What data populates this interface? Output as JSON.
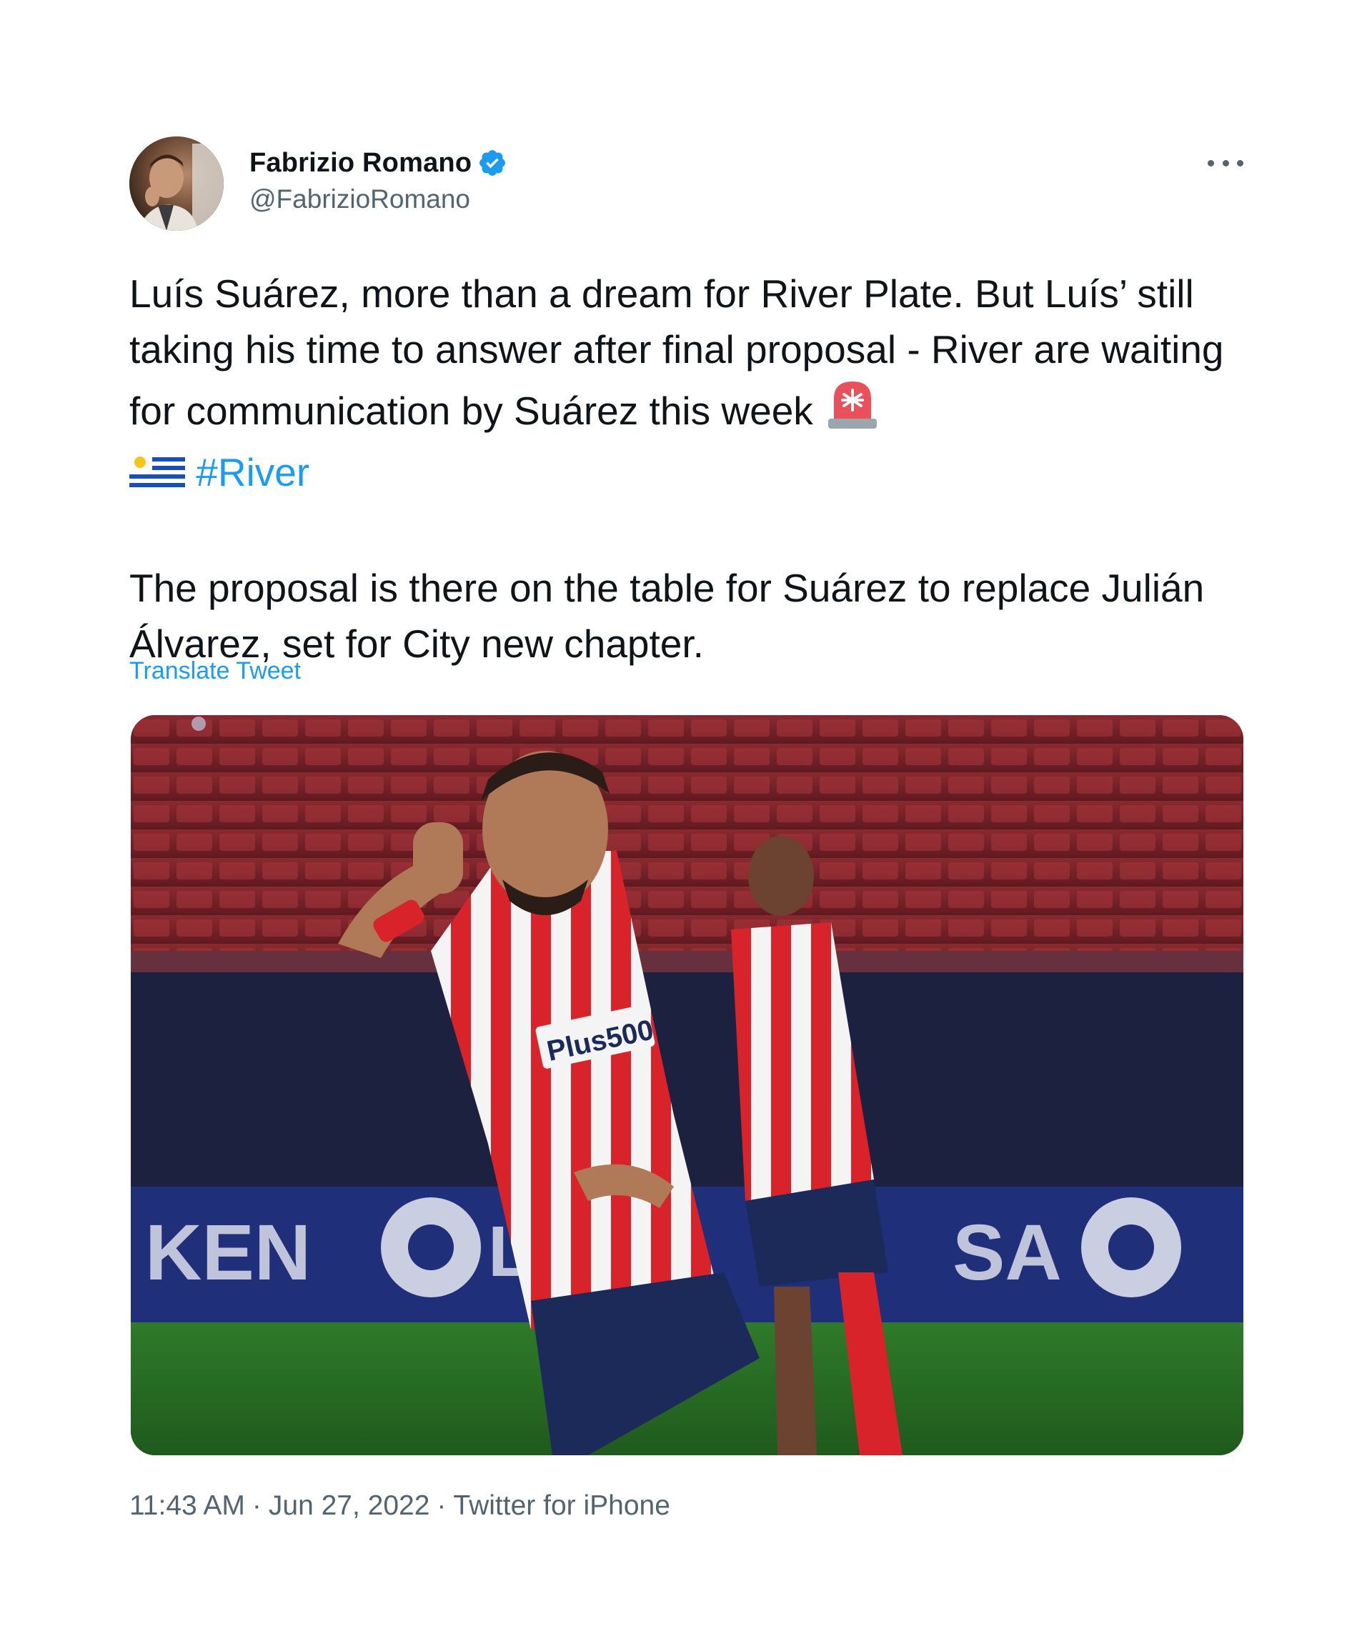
{
  "author": {
    "display_name": "Fabrizio Romano",
    "handle": "@FabrizioRomano",
    "verified": true,
    "avatar_icon": "profile-photo",
    "verified_icon": "verified-badge-icon"
  },
  "tweet": {
    "paragraph1": "Luís Suárez, more than a dream for River Plate. But Luís’ still taking his time to answer after final proposal - River are waiting for communication by Suárez this week",
    "emoji1": "rotating-light-emoji",
    "emoji2": "uruguay-flag-emoji",
    "hashtag": "#River",
    "paragraph2": "The proposal is there on the table for Suárez to replace Julián Álvarez, set for City new chapter.",
    "translate_label": "Translate Tweet"
  },
  "media": {
    "kind": "photo",
    "description_icon": "football-player-celebrating-photo"
  },
  "meta": {
    "time": "11:43 AM",
    "date": "Jun 27, 2022",
    "source": "Twitter for iPhone",
    "separator": "·"
  },
  "colors": {
    "link": "#1d9bf0",
    "text": "#0f1419",
    "muted": "#536471"
  }
}
